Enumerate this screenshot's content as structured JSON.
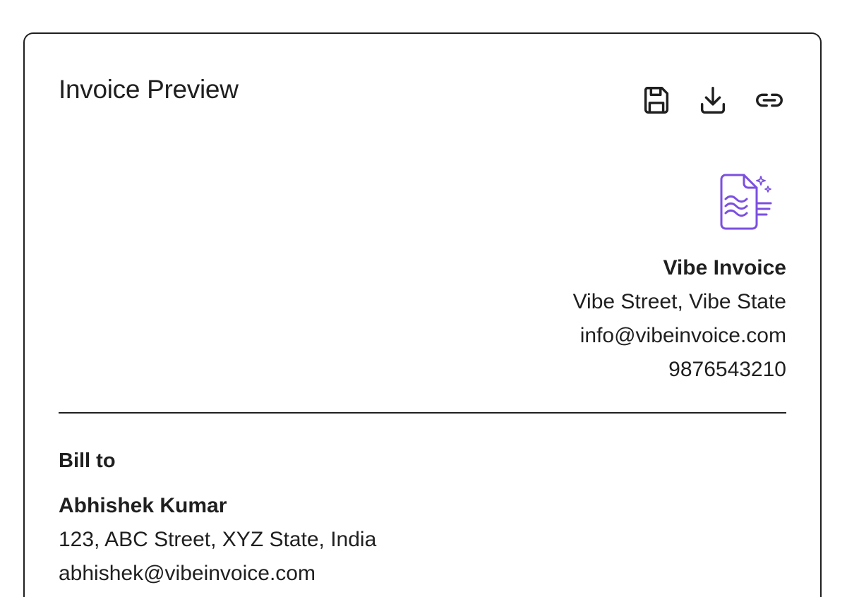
{
  "header": {
    "title": "Invoice Preview"
  },
  "toolbar": {
    "icons": [
      "save-icon",
      "download-icon",
      "link-icon"
    ]
  },
  "logo": {
    "icon": "document-sparkle-icon",
    "color": "#7b4fe0"
  },
  "company": {
    "name": "Vibe Invoice",
    "address": "Vibe Street, Vibe State",
    "email": "info@vibeinvoice.com",
    "phone": "9876543210"
  },
  "bill_to": {
    "heading": "Bill to",
    "name": "Abhishek Kumar",
    "address": "123, ABC Street, XYZ State, India",
    "email": "abhishek@vibeinvoice.com"
  }
}
